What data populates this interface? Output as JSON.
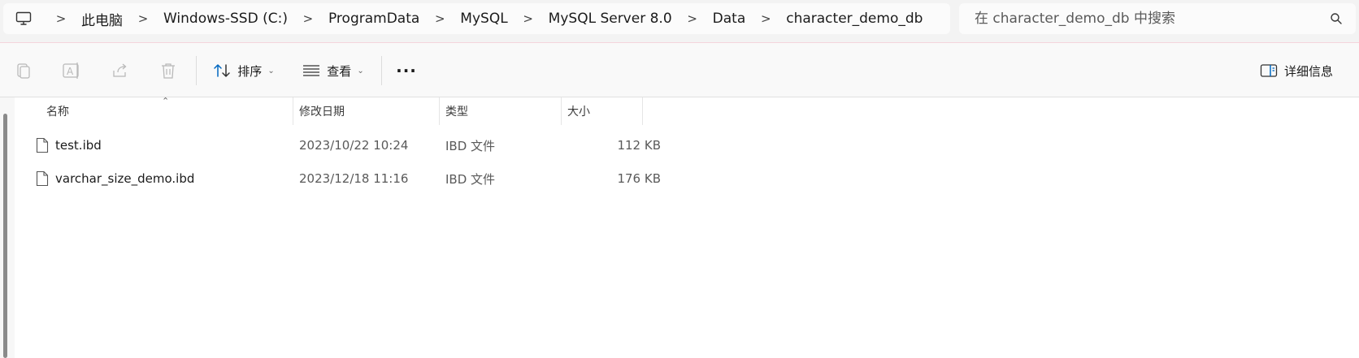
{
  "breadcrumb": {
    "items": [
      "此电脑",
      "Windows-SSD (C:)",
      "ProgramData",
      "MySQL",
      "MySQL Server 8.0",
      "Data",
      "character_demo_db"
    ],
    "separator": ">"
  },
  "search": {
    "placeholder": "在 character_demo_db 中搜索"
  },
  "toolbar": {
    "sort_label": "排序",
    "view_label": "查看",
    "more_label": "···",
    "details_label": "详细信息"
  },
  "columns": {
    "name": "名称",
    "date": "修改日期",
    "type": "类型",
    "size": "大小"
  },
  "files": [
    {
      "name": "test.ibd",
      "date": "2023/10/22 10:24",
      "type": "IBD 文件",
      "size": "112 KB"
    },
    {
      "name": "varchar_size_demo.ibd",
      "date": "2023/12/18 11:16",
      "type": "IBD 文件",
      "size": "176 KB"
    }
  ],
  "colors": {
    "accent": "#0067c0",
    "background": "#f3f3f3",
    "content": "#ffffff"
  }
}
